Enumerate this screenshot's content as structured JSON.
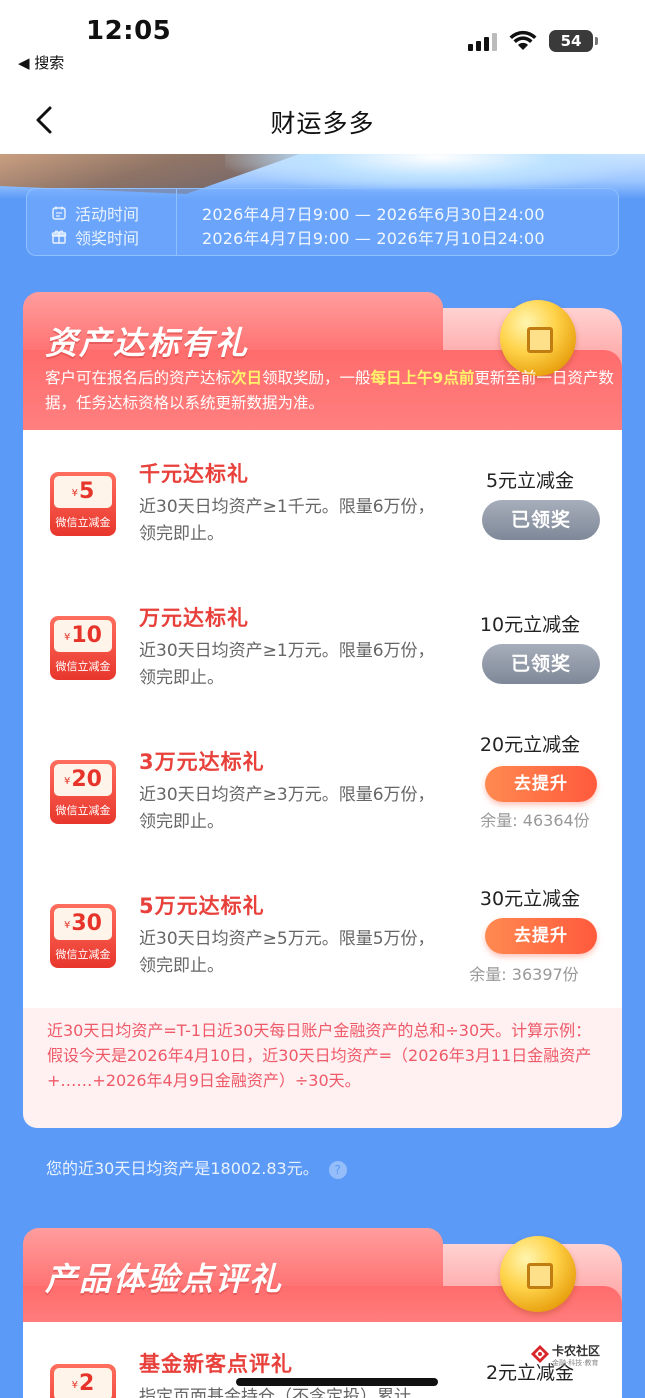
{
  "status_bar": {
    "time": "12:05",
    "back_label": "◀ 搜索",
    "battery": "54"
  },
  "nav": {
    "title": "财运多多"
  },
  "activity": {
    "activity_time_label": "活动时间",
    "activity_time_value": "2026年4月7日9:00 — 2026年6月30日24:00",
    "claim_time_label": "领奖时间",
    "claim_time_value": "2026年4月7日9:00 — 2026年7月10日24:00"
  },
  "section1": {
    "title": "资产达标有礼",
    "desc_part1": "客户可在报名后的资产达标",
    "desc_hl1": "次日",
    "desc_part2": "领取奖励，一般",
    "desc_hl2": "每日上午9点前",
    "desc_part3": "更新至前一日资产数据，任务达标资格以系统更新数据为准。",
    "items": [
      {
        "badge_value": "5",
        "badge_label": "微信立减金",
        "title": "千元达标礼",
        "desc": "近30天日均资产≥1千元。限量6万份，领完即止。",
        "amount": "5元立减金",
        "button": "已领奖",
        "remain": ""
      },
      {
        "badge_value": "10",
        "badge_label": "微信立减金",
        "title": "万元达标礼",
        "desc": "近30天日均资产≥1万元。限量6万份，领完即止。",
        "amount": "10元立减金",
        "button": "已领奖",
        "remain": ""
      },
      {
        "badge_value": "20",
        "badge_label": "微信立减金",
        "title": "3万元达标礼",
        "desc": "近30天日均资产≥3万元。限量6万份，领完即止。",
        "amount": "20元立减金",
        "button": "去提升",
        "remain": "余量: 46364份"
      },
      {
        "badge_value": "30",
        "badge_label": "微信立减金",
        "title": "5万元达标礼",
        "desc": "近30天日均资产≥5万元。限量5万份，领完即止。",
        "amount": "30元立减金",
        "button": "去提升",
        "remain": "余量: 36397份"
      }
    ],
    "currency_symbol": "¥",
    "note": "近30天日均资产=T-1日近30天每日账户金融资产的总和÷30天。计算示例：假设今天是2026年4月10日，近30天日均资产=（2026年3月11日金融资产+……+2026年4月9日金融资产）÷30天。"
  },
  "avg_asset": {
    "text": "您的近30天日均资产是18002.83元。",
    "help_icon": "?"
  },
  "section2": {
    "title": "产品体验点评礼",
    "item": {
      "badge_value": "2",
      "title": "基金新客点评礼",
      "desc": "指定页面基金持仓（不含定投）累计",
      "amount": "2元立减金"
    }
  },
  "watermark": {
    "text": "卡农社区",
    "sub": "金融·科技·教育"
  }
}
